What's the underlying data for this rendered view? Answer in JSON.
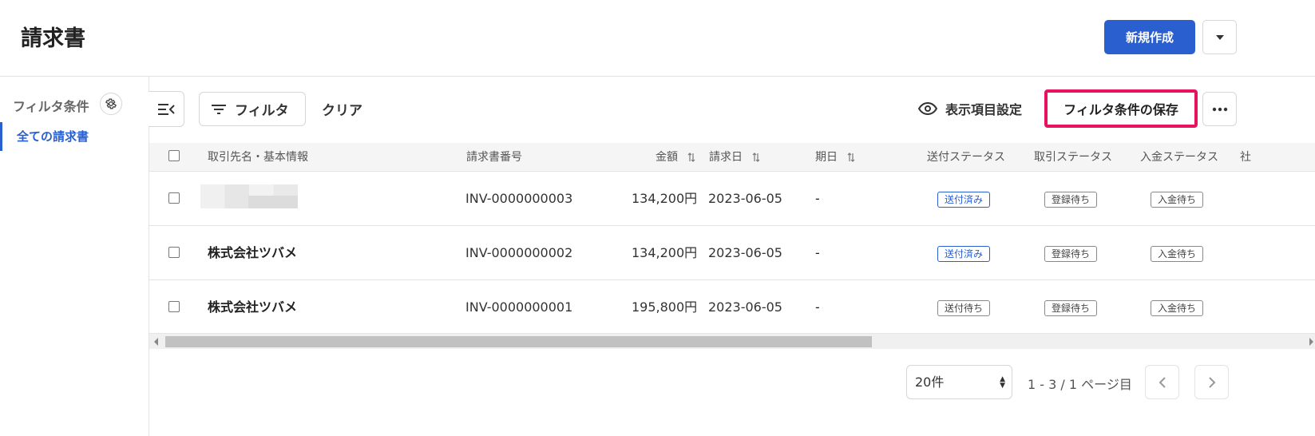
{
  "header": {
    "title": "請求書",
    "new_button": "新規作成"
  },
  "sidebar": {
    "title": "フィルタ条件",
    "items": [
      {
        "label": "全ての請求書",
        "active": true
      }
    ]
  },
  "toolbar": {
    "filter_label": "フィルタ",
    "clear_label": "クリア",
    "display_settings_label": "表示項目設定",
    "save_filter_label": "フィルタ条件の保存"
  },
  "table": {
    "columns": {
      "client": "取引先名・基本情報",
      "invoice_no": "請求書番号",
      "amount": "金額",
      "invoice_date": "請求日",
      "due_date": "期日",
      "send_status": "送付ステータス",
      "trade_status": "取引ステータス",
      "payment_status": "入金ステータス",
      "next_col": "社"
    },
    "rows": [
      {
        "client": "",
        "client_redacted": true,
        "invoice_no": "INV-0000000003",
        "amount": "134,200円",
        "invoice_date": "2023-06-05",
        "due_date": "-",
        "send_status": "送付済み",
        "trade_status": "登録待ち",
        "payment_status": "入金待ち"
      },
      {
        "client": "株式会社ツバメ",
        "invoice_no": "INV-0000000002",
        "amount": "134,200円",
        "invoice_date": "2023-06-05",
        "due_date": "-",
        "send_status": "送付済み",
        "trade_status": "登録待ち",
        "payment_status": "入金待ち"
      },
      {
        "client": "株式会社ツバメ",
        "invoice_no": "INV-0000000001",
        "amount": "195,800円",
        "invoice_date": "2023-06-05",
        "due_date": "-",
        "send_status": "送付待ち",
        "trade_status": "登録待ち",
        "payment_status": "入金待ち"
      }
    ]
  },
  "pagination": {
    "per_page": "20件",
    "info": "1 - 3 / 1 ページ目"
  },
  "colors": {
    "primary": "#2a5fcf",
    "highlight": "#e8135f"
  }
}
